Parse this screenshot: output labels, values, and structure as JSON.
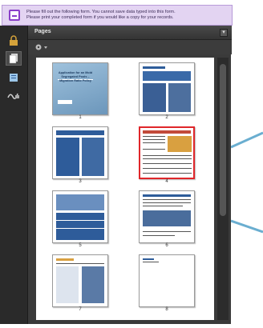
{
  "notice": {
    "line1": "Please fill out the following form. You cannot save data typed into this form.",
    "line2": "Please print your completed form if you would like a copy for your records."
  },
  "panel": {
    "title": "Pages",
    "close_glyph": "▾"
  },
  "thumbnails": [
    {
      "page": "1",
      "cover_title": "Application for an Mold Segregated Pools – Migration Ratio Policy"
    },
    {
      "page": "2"
    },
    {
      "page": "3"
    },
    {
      "page": "4",
      "selected": true
    },
    {
      "page": "5"
    },
    {
      "page": "6"
    },
    {
      "page": "7"
    },
    {
      "page": "8"
    }
  ],
  "icons": {
    "notice": "form-notice-icon",
    "toolbar": [
      "lock-icon",
      "pages-icon",
      "bookmarks-icon",
      "signature-icon"
    ],
    "options": "options-gear-icon"
  },
  "colors": {
    "notice_bg": "#e3d4f2",
    "selected_border": "#e0262a",
    "doc_blue": "#2e5c9a",
    "callout": "#6aaed0"
  }
}
